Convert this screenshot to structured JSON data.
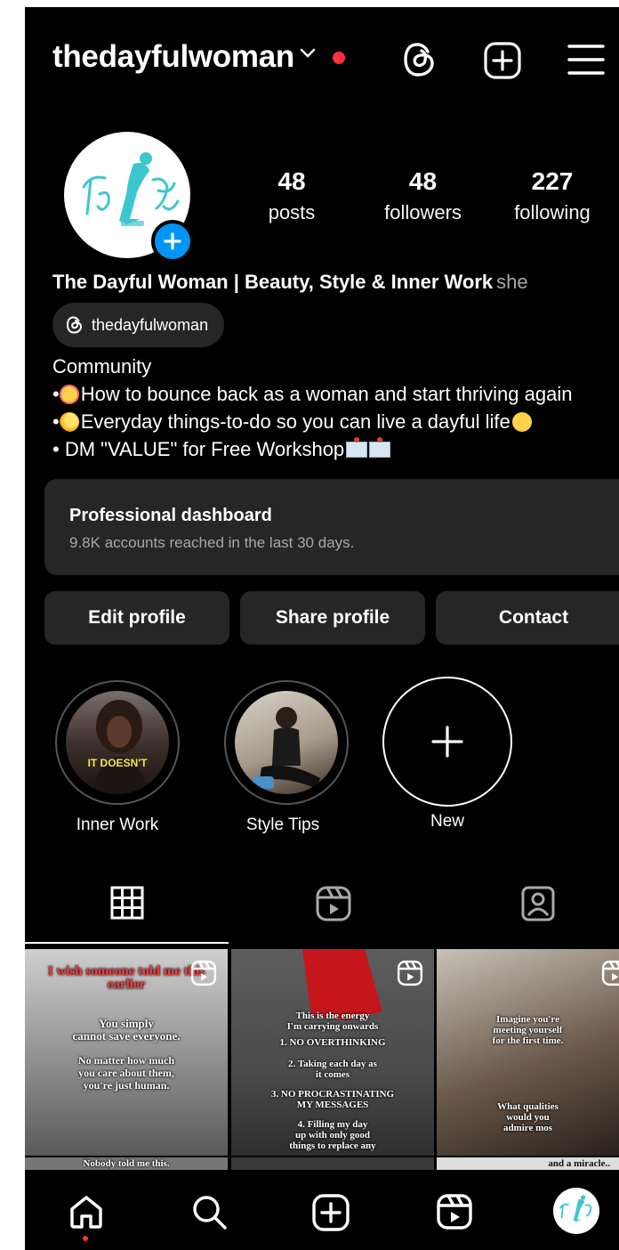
{
  "header": {
    "username": "thedayfulwoman"
  },
  "stats": [
    {
      "value": "48",
      "label": "posts"
    },
    {
      "value": "48",
      "label": "followers"
    },
    {
      "value": "227",
      "label": "following"
    }
  ],
  "profile": {
    "display_name": "The Dayful Woman | Beauty, Style & Inner Work",
    "pronoun": "she",
    "threads_handle": "thedayfulwoman",
    "category": "Community",
    "bio_lines": [
      "How to bounce back as a woman and start thriving again",
      "Everyday things-to-do so you can live a dayful life",
      "DM \"VALUE\" for Free Workshop"
    ]
  },
  "dashboard": {
    "title": "Professional dashboard",
    "subtitle": "9.8K accounts reached in the last 30 days."
  },
  "buttons": {
    "edit": "Edit profile",
    "share": "Share profile",
    "contact": "Contact"
  },
  "highlights": [
    {
      "label": "Inner Work",
      "overlay": "IT DOESN'T"
    },
    {
      "label": "Style Tips"
    },
    {
      "label": "New"
    }
  ],
  "posts": [
    {
      "lines_red": "I wish someone told me this earlier",
      "lines": [
        "You simply",
        "cannot save everyone.",
        "No matter how much",
        "you care about them,",
        "you're just human."
      ]
    },
    {
      "lines": [
        "This is the energy",
        "I'm carrying onwards",
        "1. NO OVERTHINKING",
        "2. Taking each day as",
        "it comes",
        "3. NO PROCRASTINATING",
        "MY MESSAGES",
        "4. Filling my day",
        "up with only good",
        "things to replace any"
      ]
    },
    {
      "lines": [
        "Imagine you're",
        "meeting yourself",
        "for the first time.",
        "What qualities",
        "would you",
        "admire mos"
      ]
    }
  ],
  "posts_row2": [
    "Nobody told me this.",
    "and a miracle.."
  ],
  "colors": {
    "accent": "#0095f6",
    "notification": "#ff3040",
    "button_bg": "#262626",
    "brand_teal": "#3cc6cf"
  }
}
